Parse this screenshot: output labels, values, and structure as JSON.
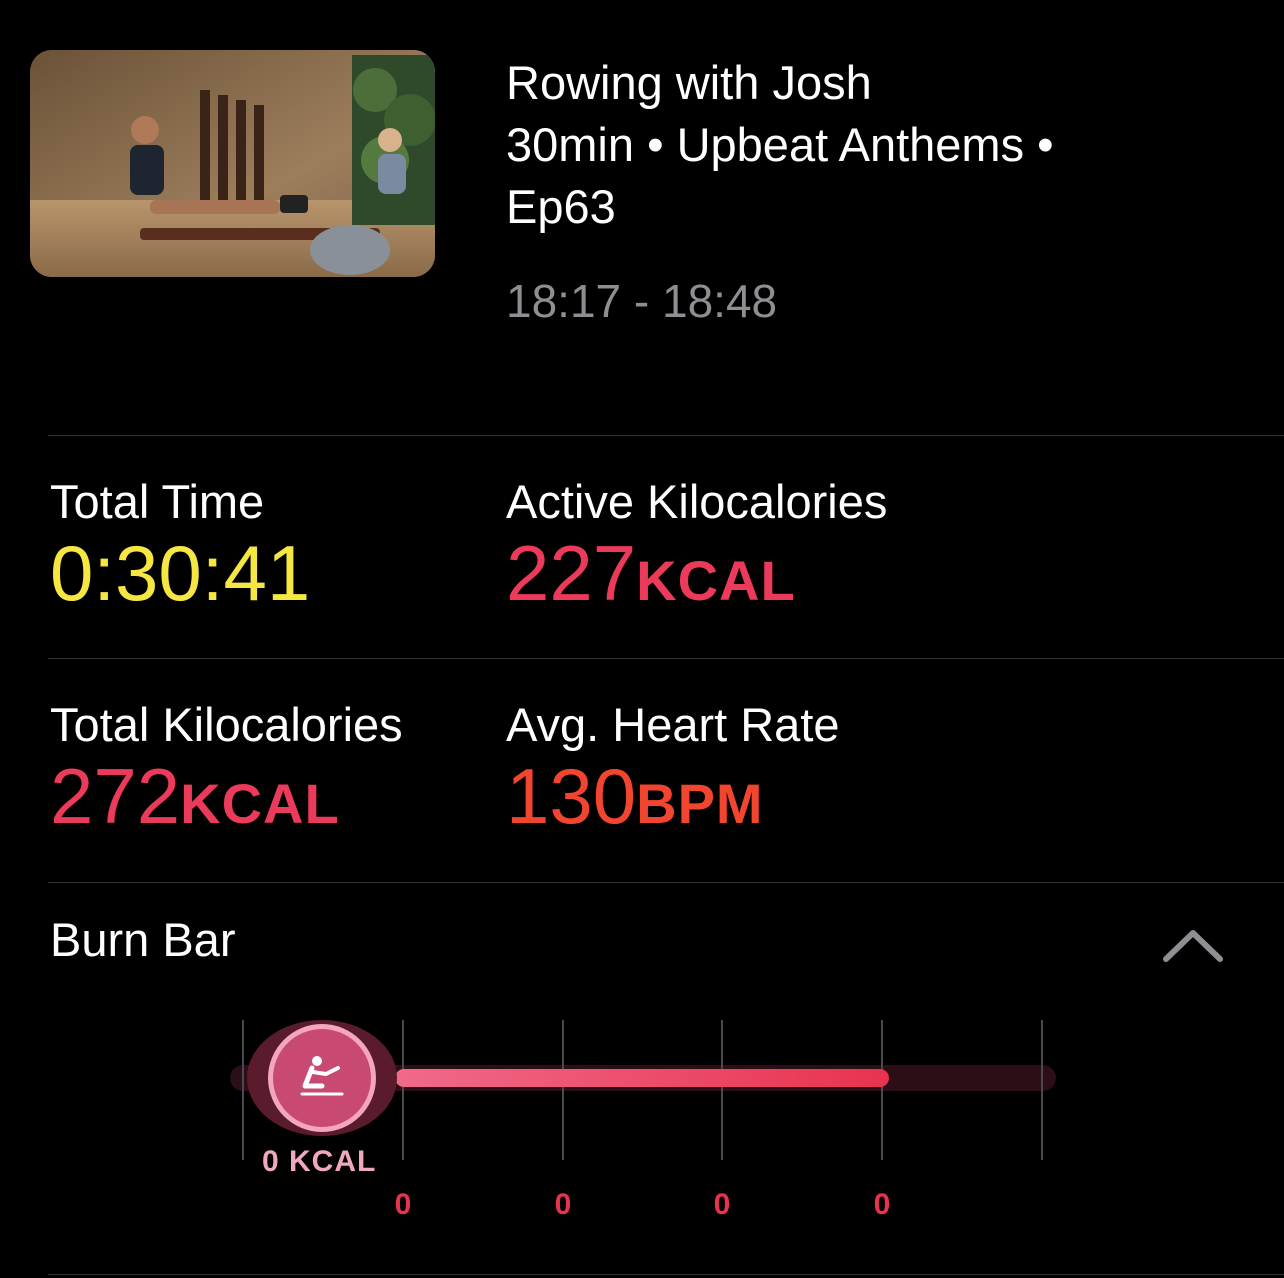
{
  "workout": {
    "title": "Rowing with Josh",
    "subtitle": "30min • Upbeat Anthems •",
    "episode": "Ep63",
    "time_range": "18:17 - 18:48"
  },
  "metrics": {
    "total_time": {
      "label": "Total Time",
      "value": "0:30:41",
      "unit": "",
      "color": "#f5e642"
    },
    "active_kcal": {
      "label": "Active Kilocalories",
      "value": "227",
      "unit": "KCAL",
      "color": "#ec3a5b"
    },
    "total_kcal": {
      "label": "Total Kilocalories",
      "value": "272",
      "unit": "KCAL",
      "color": "#ec3a5b"
    },
    "avg_hr": {
      "label": "Avg. Heart Rate",
      "value": "130",
      "unit": "BPM",
      "color": "#f2452f"
    }
  },
  "burn_bar": {
    "title": "Burn Bar",
    "marker_label": "0 KCAL",
    "tick_labels": [
      "0",
      "0",
      "0",
      "0"
    ],
    "expand_icon": "chevron-up-icon",
    "rower_icon": "rowing-icon",
    "accent": "#e8334f"
  }
}
